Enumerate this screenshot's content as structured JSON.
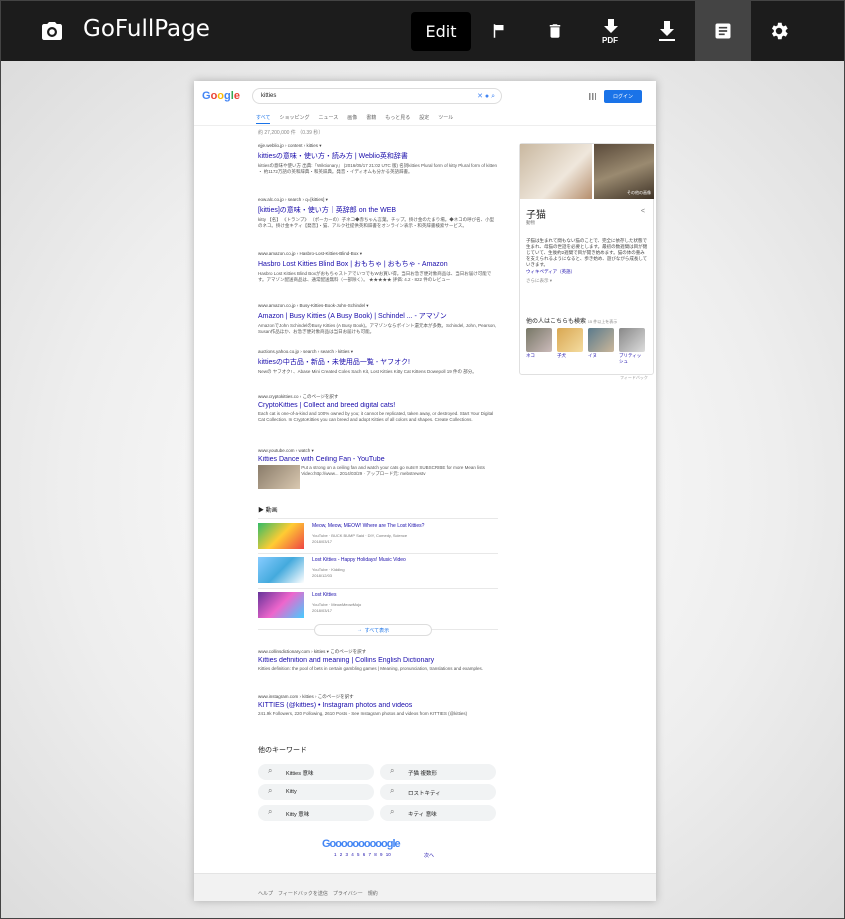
{
  "app": {
    "title": "GoFullPage",
    "edit_label": "Edit",
    "pdf_label": "PDF"
  },
  "google": {
    "logo": [
      "G",
      "o",
      "o",
      "g",
      "l",
      "e"
    ],
    "query": "kitties",
    "login": "ログイン",
    "tabs": [
      "すべて",
      "ショッピング",
      "ニュース",
      "画像",
      "書籍",
      "もっと見る",
      "設定",
      "ツール"
    ],
    "stats": "約 27,200,000 件 （0.39 秒）",
    "results": [
      {
        "url": "ejje.weblio.jp › content › kitties ▾",
        "title": "kittiesの意味・使い方・読み方 | Weblio英和辞書",
        "snippet": "kittiesの意味や使い方 出典:『Wiktionary』 (2016/05/17 21:02 UTC 版) 名詞kitties Plural form of kitty Plural form of kitten ・ 約1172万語の英和辞典・和英辞典。発音・イディオムも分かる英語辞書。"
      },
      {
        "url": "eow.alc.co.jp › search › q=[kitties] ▾",
        "title": "[kitties]の意味・使い方｜英辞郎 on the WEB",
        "snippet": "kitty 【名】 《トランプ》 （ポーカーの）子ネコ◆赤ちゃん言葉。チップ。掛け金のたまり場。◆ネコの呼び名、小型のネコ。掛け金キティ【発音】・猫、アルク社提供英和辞書をオンライン表示・和英辞書検索サービス。"
      },
      {
        "url": "www.amazon.co.jp › Hasbro-Lost-Kitties-Blind-Box ▾",
        "title": "Hasbro Lost Kitties Blind Box | おもちゃ | おもちゃ - Amazon",
        "snippet": "Hasbro Lost Kitties Blind BoxがおもちゃストアでいつでもWお買い得。当日お急ぎ便対象商品は、当日お届け可能です。アマゾン配送商品は、通常配送無料（一部除く）。 ★★★★★ 評価: 4.2 - 822 件のレビュー"
      },
      {
        "url": "www.amazon.co.jp › Busy-Kitties-Book-John-Schindel ▾",
        "title": "Amazon | Busy Kitties (A Busy Book) | Schindel ... - アマゾン",
        "snippet": "AmazonでJohn SchindelのBusy Kitties (A Busy Book)。アマゾンならポイント還元本が多数。Schindel, John, Pearson, Susan作品ほか、お急ぎ便対象商品は当日お届けも可能。"
      },
      {
        "url": "auctions.yahoo.co.jp › search › search › kitties ▾",
        "title": "kittiesの中古品・新品・未使用品一覧 - ヤフオク!",
        "snippet": "Newの ヤフオク! 、Abase Mini Created Coles Sach Kit, Lost Kitties Kitty Cat Kittens Dowepoll 19 件の 部分。"
      },
      {
        "url": "www.cryptokitties.co › このページを訳す",
        "title": "CryptoKitties | Collect and breed digital cats!",
        "snippet": "Each cat is one-of-a-kind and 100% owned by you; it cannot be replicated, taken away, or destroyed. Start Your Digital Cat Collection. In CryptoKitties you can breed and adopt Kitties of all colors and shapes. Create Collections."
      },
      {
        "url": "www.youtube.com › watch ▾",
        "title": "Kitties Dance with Ceiling Fan - YouTube",
        "snippet": "Put a strong on a ceiling fan and watch your cats go nuts!!! SUBSCRIBE for more Mean lists Video:http://www... 2014/03/29 · アップロード元: mebstrewstv"
      }
    ],
    "videos_heading": "動画",
    "videos": [
      {
        "title": "Meow, Meow, MEOW! Where are The Lost Kitties?",
        "meta1": "YouTube · BUCK BUMP Said · DIY, Comedy, Science",
        "meta2": "2018/03/17",
        "duration": "4:51"
      },
      {
        "title": "Lost Kitties - Happy Holidays! Music Video",
        "meta1": "YouTube · Kidding",
        "meta2": "2018/12/03",
        "duration": "1:52"
      },
      {
        "title": "Lost Kitties",
        "meta1": "YouTube · MeowMeowMojo",
        "meta2": "2018/03/17",
        "duration": "1:28"
      }
    ],
    "more_videos": "すべて表示",
    "results2": [
      {
        "url": "www.collinsdictionary.com › kitties ▾ このページを訳す",
        "title": "Kitties definition and meaning | Collins English Dictionary",
        "snippet": "Kitties definition: the pool of bets in certain gambling games | Meaning, pronunciation, translations and examples."
      },
      {
        "url": "www.instagram.com › kitties › このページを訳す",
        "title": "KITTIES (@kitties) • Instagram photos and videos",
        "snippet": "241.9k Followers, 220 Following, 2610 Posts - See Instagram photos and videos from KITTIES (@kitties)"
      }
    ],
    "knowledge": {
      "title": "子猫",
      "subtitle": "動物",
      "description": "子猫は生まれて間もない猫のことで、完全に依存した状態で生まれ、母猫の世話を必要とします。最初の数週間は目が閉じていて、生後約2週間で目が開き始めます。猫の体の重みを支えられるようになると、歩き始め、遊びながら成長していきます。",
      "source": "ウィキペディア（英語）",
      "feedback_link": "さらに表示 ▾",
      "img_caption": "その他の画像",
      "also_search": "他の人はこちらも検索",
      "also_note": "15 件以上を表示",
      "pets": [
        "ネコ",
        "子犬",
        "イヌ",
        "ブリティッシュ"
      ],
      "feedback": "フィードバック"
    },
    "related_heading": "他のキーワード",
    "related": [
      "Kitties 意味",
      "子猫 複数形",
      "Kitty",
      "ロストキティ",
      "Kitty 意味",
      "キティ 意味"
    ],
    "pager_logo": "Goooooooooogle",
    "page_numbers": "1 2 3 4 5 6 7 8 9 10",
    "next_label": "次へ",
    "footer": "ヘルプ　フィードバックを送信　プライバシー　規約"
  }
}
